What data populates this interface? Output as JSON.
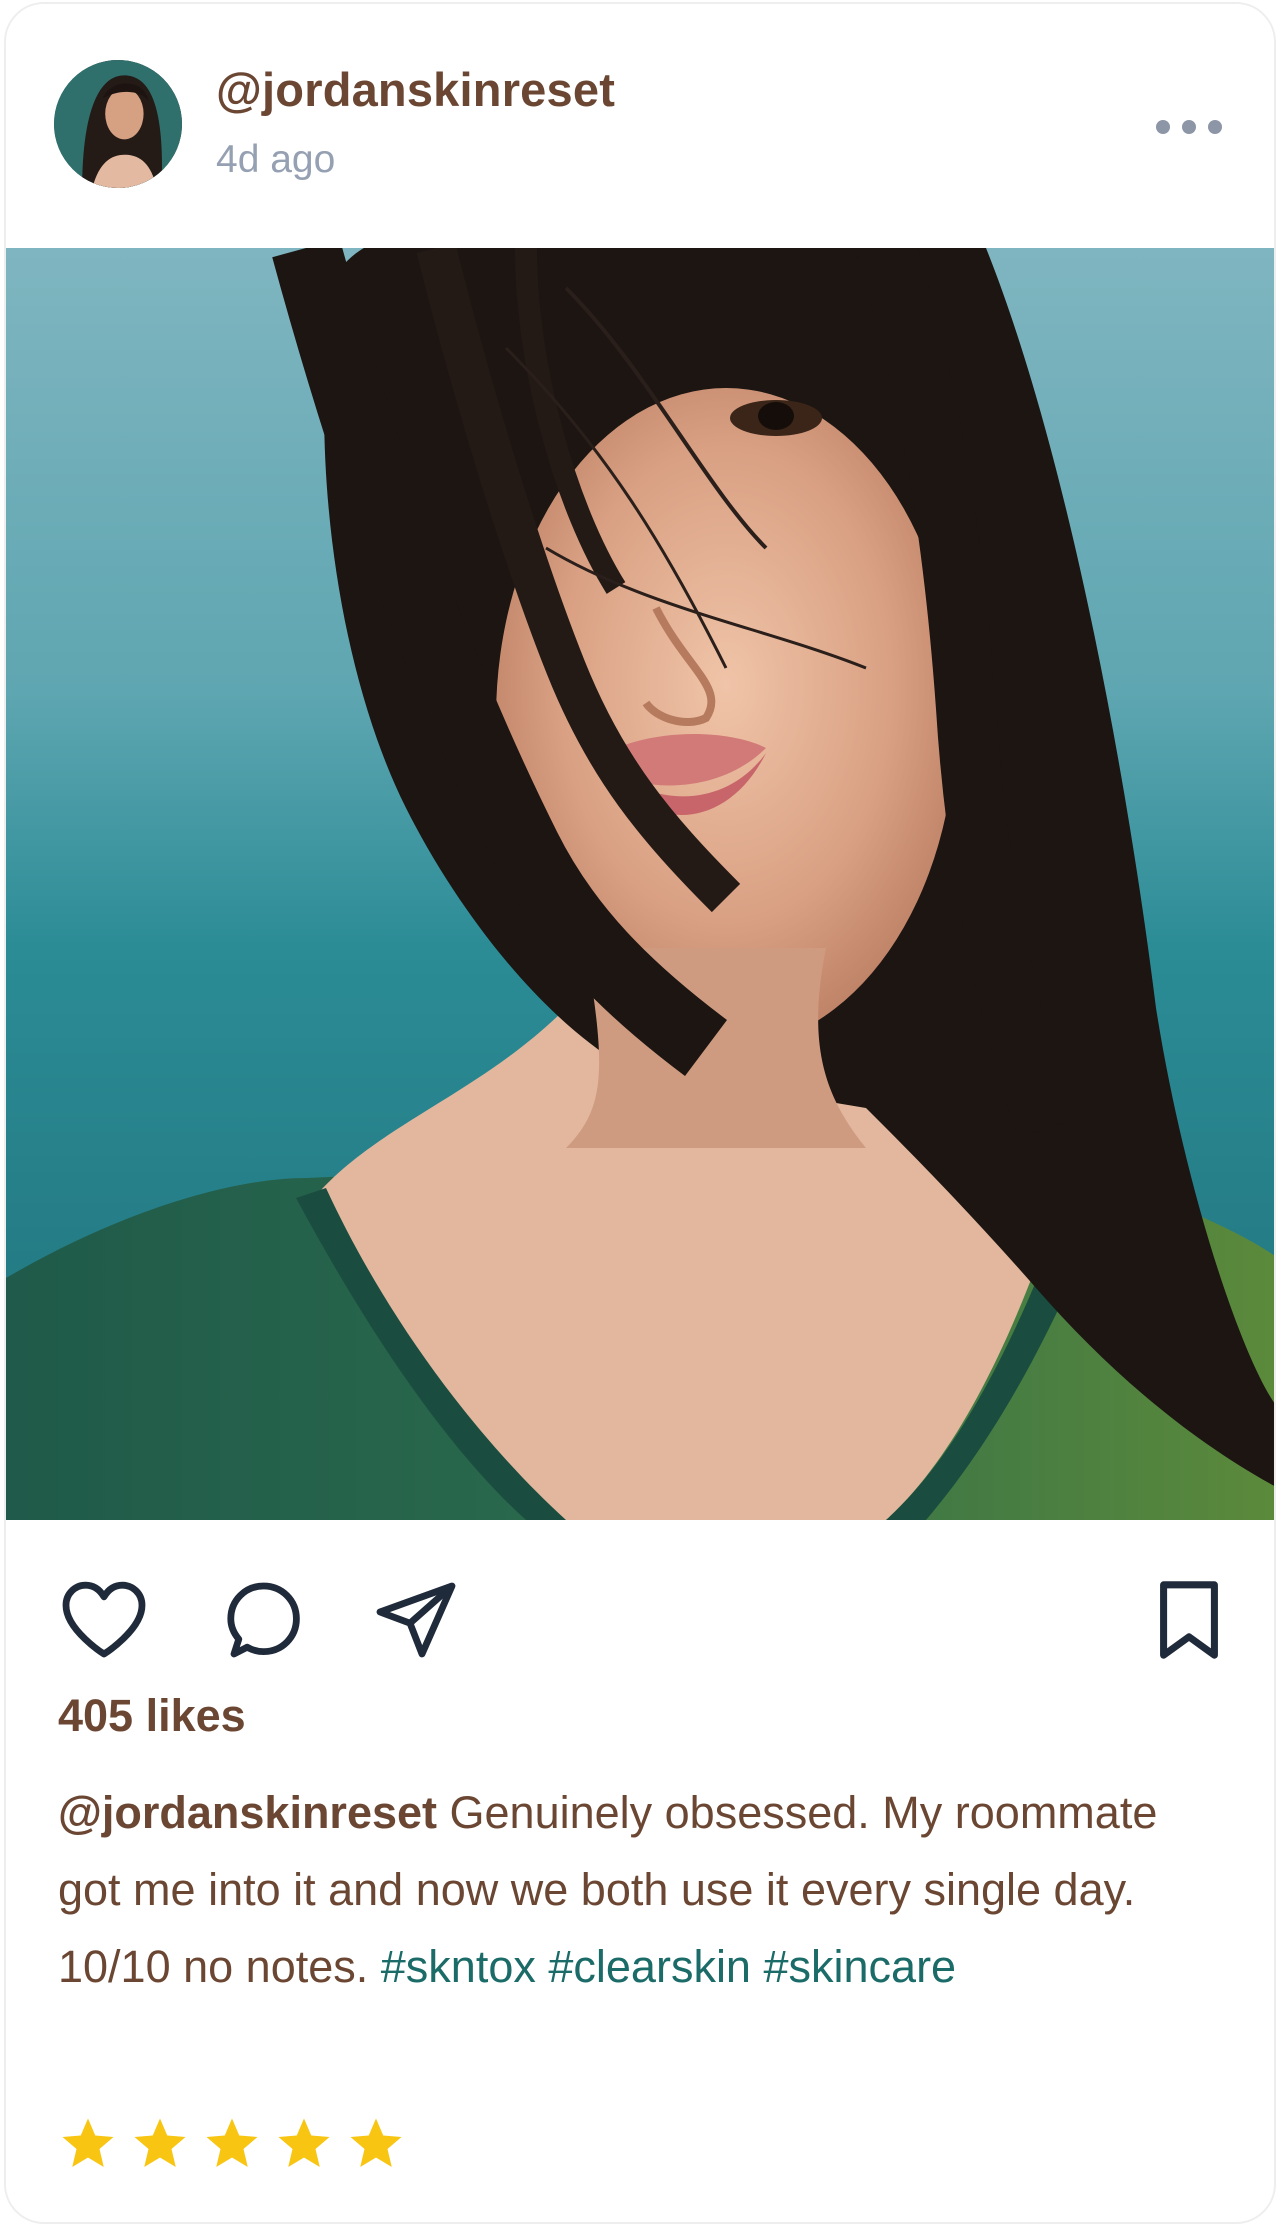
{
  "post": {
    "username": "@jordanskinreset",
    "timestamp": "4d ago",
    "more_icon": "more-horizontal-icon",
    "photo_description_icon": "post-photo",
    "actions": {
      "like_icon": "heart-icon",
      "comment_icon": "comment-icon",
      "share_icon": "send-icon",
      "save_icon": "bookmark-icon"
    },
    "likes": "405 likes",
    "caption": {
      "user": "@jordanskinreset",
      "text": " Genuinely obsessed. My roommate got me into it and now we both use it every single day. 10/10 no notes. ",
      "hashtags": [
        "#skntox",
        "#clearskin",
        "#skincare"
      ]
    },
    "rating": {
      "stars": 5,
      "max": 5
    },
    "colors": {
      "username": "#6b4733",
      "timestamp": "#95a0b2",
      "hashtag": "#1b6b68",
      "icon": "#1f2a3a",
      "star": "#f7c512"
    }
  }
}
